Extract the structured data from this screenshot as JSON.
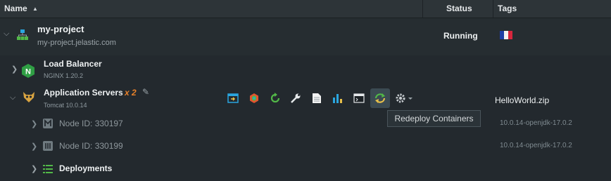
{
  "header": {
    "name": "Name",
    "status": "Status",
    "tags": "Tags"
  },
  "project": {
    "name": "my-project",
    "domain": "my-project.jelastic.com",
    "status": "Running",
    "tag_icon": "flag-icon",
    "flag_colors": [
      "#1f3fa6",
      "#f2f2f2",
      "#d7263d"
    ]
  },
  "load_balancer": {
    "name": "Load Balancer",
    "version": "NGINX 1.20.2"
  },
  "app_servers": {
    "name": "Application Servers",
    "count": "x 2",
    "version": "Tomcat 10.0.14",
    "tag": "HelloWorld.zip"
  },
  "nodes": [
    {
      "label": "Node ID: 330197",
      "tag": "10.0.14-openjdk-17.0.2"
    },
    {
      "label": "Node ID: 330199",
      "tag": "10.0.14-openjdk-17.0.2"
    }
  ],
  "deployments": {
    "name": "Deployments"
  },
  "tooltip": "Redeploy Containers"
}
